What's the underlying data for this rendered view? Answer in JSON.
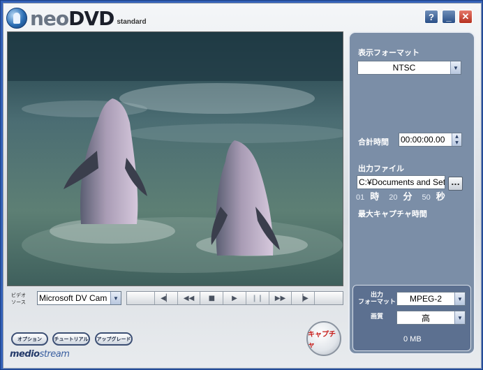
{
  "app": {
    "name_a": "neo",
    "name_b": "DVD",
    "edition": "standard"
  },
  "window_buttons": {
    "help": "?",
    "minimize": "_",
    "close": "✕"
  },
  "panel": {
    "display_format_label": "表示フォーマット",
    "display_format_value": "NTSC",
    "total_time_label": "合計時間",
    "total_time_value": "00:00:00.00",
    "output_file_label": "出力ファイル",
    "output_file_value": "C:¥Documents and Setti",
    "browse_label": "...",
    "max_capture_label": "最大キャプチャ時間",
    "max_capture": [
      {
        "value": "01",
        "unit": "時"
      },
      {
        "value": "20",
        "unit": "分"
      },
      {
        "value": "50",
        "unit": "秒"
      }
    ]
  },
  "output": {
    "format_label_1": "出力",
    "format_label_2": "フォーマット",
    "format_value": "MPEG-2",
    "quality_label": "画質",
    "quality_value": "高",
    "size": "0 MB"
  },
  "source": {
    "label_1": "ビデオ",
    "label_2": "ソース",
    "value": "Microsoft DV Cam"
  },
  "transport": {
    "frame_back": "◀▏",
    "rewind": "◀◀",
    "stop": "■",
    "play": "▶",
    "pause": "❙❙",
    "fast_forward": "▶▶",
    "frame_forward": "▕▶"
  },
  "buttons": {
    "options": "オプション",
    "tutorial": "チュートリアル",
    "upgrade": "アップグレード",
    "capture": "キャプチャ"
  },
  "brand": {
    "part_a": "medio",
    "part_b": "stream"
  }
}
